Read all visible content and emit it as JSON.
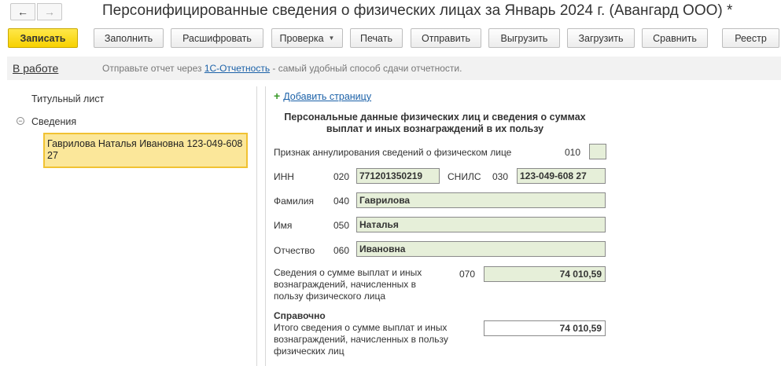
{
  "window": {
    "title": "Персонифицированные сведения о физических лицах за Январь 2024 г. (Авангард ООО) *"
  },
  "toolbar": {
    "buttons": [
      {
        "label": "Записать"
      },
      {
        "label": "Заполнить"
      },
      {
        "label": "Расшифровать"
      },
      {
        "label": "Проверка"
      },
      {
        "label": "Печать"
      },
      {
        "label": "Отправить"
      },
      {
        "label": "Выгрузить"
      },
      {
        "label": "Загрузить"
      },
      {
        "label": "Сравнить"
      },
      {
        "label": "Реестр"
      }
    ]
  },
  "status": {
    "state": "В работе",
    "hint_before": "Отправьте отчет через ",
    "hint_link": "1С-Отчетность",
    "hint_after": " - самый удобный способ сдачи отчетности."
  },
  "tree": {
    "title_page": "Титульный лист",
    "section": "Сведения",
    "selected_item": "Гаврилова Наталья Ивановна 123-049-608 27"
  },
  "form": {
    "add_page": "Добавить страницу",
    "heading": "Персональные данные физических лиц и сведения о суммах выплат и иных вознаграждений в их пользу",
    "annul_label": "Признак аннулирования сведений о физическом лице",
    "annul_code": "010",
    "inn_label": "ИНН",
    "inn_code": "020",
    "inn_value": "771201350219",
    "snils_label": "СНИЛС",
    "snils_code": "030",
    "snils_value": "123-049-608 27",
    "surname_label": "Фамилия",
    "surname_code": "040",
    "surname_value": "Гаврилова",
    "name_label": "Имя",
    "name_code": "050",
    "name_value": "Наталья",
    "patronymic_label": "Отчество",
    "patronymic_code": "060",
    "patronymic_value": "Ивановна",
    "payments_label": "Сведения о сумме выплат и иных вознаграждений, начисленных в пользу физического лица",
    "payments_code": "070",
    "payments_value": "74 010,59",
    "reference_heading": "Справочно",
    "total_label": "Итого сведения о сумме выплат и иных вознаграждений, начисленных в пользу физических лиц",
    "total_value": "74 010,59"
  }
}
